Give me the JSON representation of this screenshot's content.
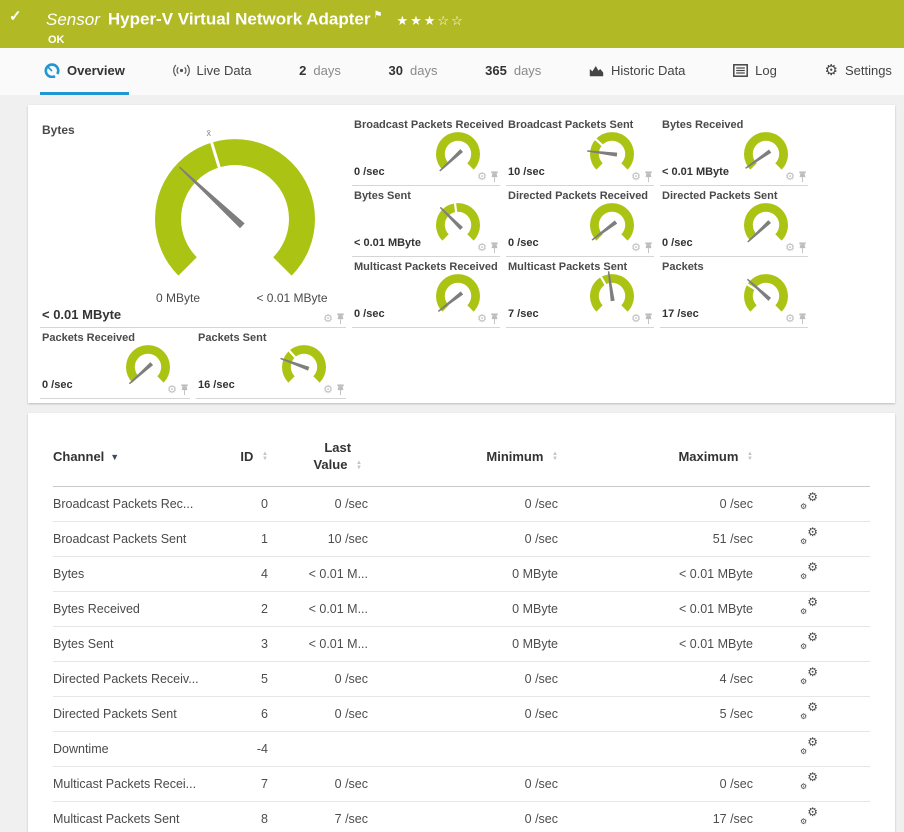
{
  "colors": {
    "header_green": "#b1ba25",
    "gauge_green": "#abc312",
    "needle": "#7e7e7e",
    "accent_blue": "#2196d3"
  },
  "header": {
    "check_glyph": "✓",
    "kind_label": "Sensor",
    "title": "Hyper-V Virtual Network Adapter",
    "flag_glyph": "⚑",
    "stars": "★★★☆☆",
    "status": "OK"
  },
  "tabs": [
    {
      "id": "overview",
      "label": "Overview",
      "icon": "gauge-icon",
      "active": true
    },
    {
      "id": "live-data",
      "label": "Live Data",
      "icon": "live-data-icon",
      "active": false
    },
    {
      "id": "2-days",
      "num": "2",
      "label": "days",
      "active": false
    },
    {
      "id": "30-days",
      "num": "30",
      "label": "days",
      "active": false
    },
    {
      "id": "365-days",
      "num": "365",
      "label": "days",
      "active": false
    },
    {
      "id": "historic-data",
      "label": "Historic Data",
      "icon": "historic-data-icon",
      "active": false
    },
    {
      "id": "log",
      "label": "Log",
      "icon": "log-icon",
      "active": false
    },
    {
      "id": "settings",
      "label": "Settings",
      "icon": "settings-gear-icon",
      "active": false
    }
  ],
  "gauges": {
    "big": {
      "label": "Bytes",
      "value": "< 0.01 MByte",
      "scale_min_label": "0 MByte",
      "scale_max_label": "< 0.01 MByte",
      "needle_deg": -47,
      "avg_deg": -17,
      "avg_label": "x̄"
    },
    "small": [
      {
        "label": "Broadcast Packets Received",
        "value": "0 /sec",
        "needle_deg": -133,
        "avg_deg": null
      },
      {
        "label": "Broadcast Packets Sent",
        "value": "10 /sec",
        "needle_deg": -83,
        "avg_deg": -48
      },
      {
        "label": "Bytes Received",
        "value": "< 0.01 MByte",
        "needle_deg": -125,
        "avg_deg": null
      },
      {
        "label": "Bytes Sent",
        "value": "< 0.01 MByte",
        "needle_deg": -45,
        "avg_deg": -8
      },
      {
        "label": "Directed Packets Received",
        "value": "0 /sec",
        "needle_deg": -127,
        "avg_deg": null
      },
      {
        "label": "Directed Packets Sent",
        "value": "0 /sec",
        "needle_deg": -133,
        "avg_deg": null
      },
      {
        "label": "Multicast Packets Received",
        "value": "0 /sec",
        "needle_deg": -128,
        "avg_deg": null
      },
      {
        "label": "Multicast Packets Sent",
        "value": "7 /sec",
        "needle_deg": -8,
        "avg_deg": -30
      },
      {
        "label": "Packets",
        "value": "17 /sec",
        "needle_deg": -48,
        "avg_deg": -58
      },
      {
        "label": "Packets Received",
        "value": "0 /sec",
        "needle_deg": -132,
        "avg_deg": null
      },
      {
        "label": "Packets Sent",
        "value": "16 /sec",
        "needle_deg": -70,
        "avg_deg": -42
      }
    ]
  },
  "table": {
    "columns": [
      {
        "label": "Channel",
        "sort": "active"
      },
      {
        "label": "ID",
        "sort": "both"
      },
      {
        "label": "Last Value",
        "sort": "both",
        "two_line": true
      },
      {
        "label": "Minimum",
        "sort": "both"
      },
      {
        "label": "Maximum",
        "sort": "both"
      },
      {
        "label": "",
        "sort": "none"
      }
    ],
    "rows": [
      {
        "channel": "Broadcast Packets Rec...",
        "id": "0",
        "last": "0 /sec",
        "min": "0 /sec",
        "max": "0 /sec"
      },
      {
        "channel": "Broadcast Packets Sent",
        "id": "1",
        "last": "10 /sec",
        "min": "0 /sec",
        "max": "51 /sec"
      },
      {
        "channel": "Bytes",
        "id": "4",
        "last": "< 0.01 M...",
        "min": "0 MByte",
        "max": "< 0.01 MByte"
      },
      {
        "channel": "Bytes Received",
        "id": "2",
        "last": "< 0.01 M...",
        "min": "0 MByte",
        "max": "< 0.01 MByte"
      },
      {
        "channel": "Bytes Sent",
        "id": "3",
        "last": "< 0.01 M...",
        "min": "0 MByte",
        "max": "< 0.01 MByte"
      },
      {
        "channel": "Directed Packets Receiv...",
        "id": "5",
        "last": "0 /sec",
        "min": "0 /sec",
        "max": "4 /sec"
      },
      {
        "channel": "Directed Packets Sent",
        "id": "6",
        "last": "0 /sec",
        "min": "0 /sec",
        "max": "5 /sec"
      },
      {
        "channel": "Downtime",
        "id": "-4",
        "last": "",
        "min": "",
        "max": ""
      },
      {
        "channel": "Multicast Packets Recei...",
        "id": "7",
        "last": "0 /sec",
        "min": "0 /sec",
        "max": "0 /sec"
      },
      {
        "channel": "Multicast Packets Sent",
        "id": "8",
        "last": "7 /sec",
        "min": "0 /sec",
        "max": "17 /sec"
      }
    ]
  }
}
